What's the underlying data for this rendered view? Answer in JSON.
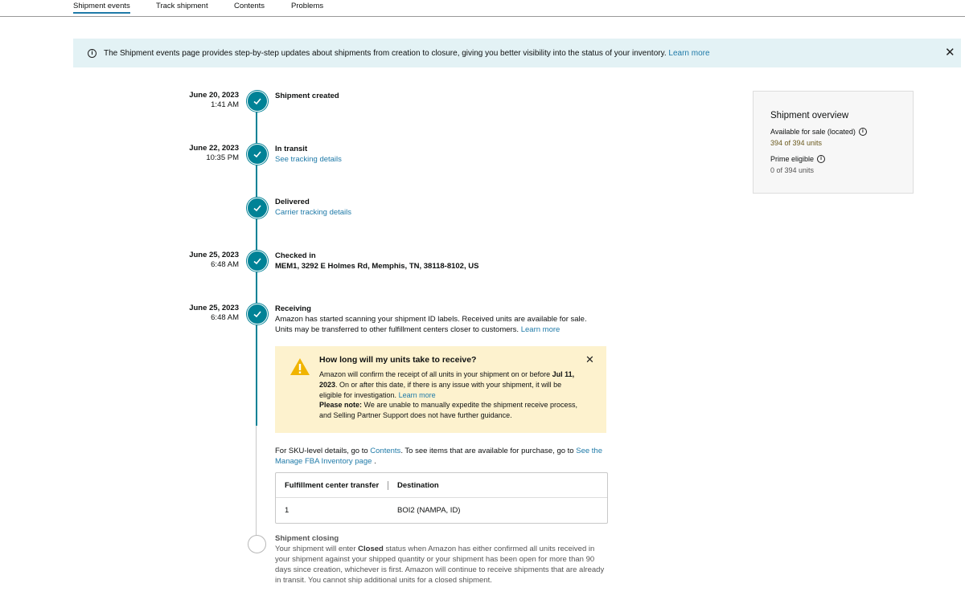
{
  "tabs": [
    {
      "label": "Shipment events",
      "active": true
    },
    {
      "label": "Track shipment",
      "active": false
    },
    {
      "label": "Contents",
      "active": false
    },
    {
      "label": "Problems",
      "active": false
    }
  ],
  "banner": {
    "text": "The Shipment events page provides step-by-step updates about shipments from creation to closure, giving you better visibility into the status of your inventory.",
    "link": "Learn more"
  },
  "events": [
    {
      "date": "June 20, 2023",
      "time": "1:41 AM",
      "title": "Shipment created"
    },
    {
      "date": "June 22, 2023",
      "time": "10:35 PM",
      "title": "In transit",
      "link": "See tracking details"
    },
    {
      "date": "",
      "time": "",
      "title": "Delivered",
      "link": "Carrier tracking details"
    },
    {
      "date": "June 25, 2023",
      "time": "6:48 AM",
      "title": "Checked in",
      "detail": "MEM1, 3292 E Holmes Rd, Memphis, TN, 38118-8102, US"
    },
    {
      "date": "June 25, 2023",
      "time": "6:48 AM",
      "title": "Receiving",
      "detail": "Amazon has started scanning your shipment ID labels. Received units are available for sale. Units may be transferred to other fulfillment centers closer to customers.",
      "link": "Learn more"
    }
  ],
  "warning": {
    "title": "How long will my units take to receive?",
    "body1": "Amazon will confirm the receipt of all units in your shipment on or before",
    "date": "Jul 11, 2023",
    "body2": ". On or after this date, if there is any issue with your shipment, it will be eligible for investigation.",
    "link": "Learn more",
    "note_label": "Please note:",
    "note": "We are unable to manually expedite the shipment receive process, and Selling Partner Support does not have further guidance."
  },
  "sku": {
    "prefix": "For SKU-level details, go to",
    "contents_link": "Contents",
    "middle": ". To see items that are available for purchase, go to",
    "manage_link": "See the Manage FBA Inventory page",
    "suffix": "."
  },
  "transfer_table": {
    "headers": [
      "Fulfillment center transfer",
      "Destination"
    ],
    "rows": [
      [
        "1",
        "BOI2 (NAMPA, ID)"
      ]
    ]
  },
  "closing": {
    "title": "Shipment closing",
    "pre": "Your shipment will enter",
    "status": "Closed",
    "post": "status when Amazon has either confirmed all units received in your shipment against your shipped quantity or your shipment has been open for more than 90 days since creation, whichever is first. Amazon will continue to receive shipments that are already in transit. You cannot ship additional units for a closed shipment."
  },
  "overview": {
    "title": "Shipment overview",
    "available_label": "Available for sale (located)",
    "available_value": "394 of 394 units",
    "prime_label": "Prime eligible",
    "prime_value": "0 of 394 units"
  },
  "colors": {
    "accent": "#008296",
    "link": "#1f7aa8",
    "banner": "#e3f2f5",
    "warning_bg": "#fdf2ce",
    "warning_icon": "#f0b400",
    "available_value": "#6b5a1e"
  }
}
